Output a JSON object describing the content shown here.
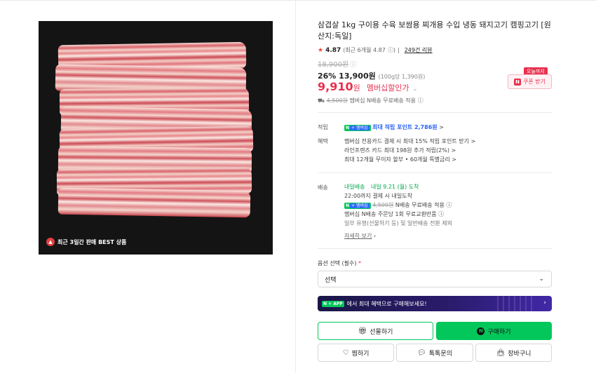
{
  "product": {
    "title": "삼겹살 1kg 구이용 수육 보쌈용 찌개용 수입 냉동 돼지고기 캠핑고기 [원산지:독일]",
    "image_badge": "최근 3일간 판매 BEST 상품",
    "rating_score": "4.87",
    "rating_recent": "(최근 6개월 4.87",
    "review_count": "249건 리뷰",
    "original_price": "18,900원",
    "discount_line": "26% 13,900원",
    "unit_price": "(100g당 1,390원)",
    "member_price": "9,910",
    "member_price_won": "원",
    "member_price_label": "멤버십할인가",
    "shipping_old": "4,500원",
    "shipping_text": "멤버십 N배송 무료배송 적용"
  },
  "coupon": {
    "tag": "오늘까지",
    "button_label": "쿠폰 받기"
  },
  "points": {
    "label": "적립",
    "pill_n": "N",
    "pill_m": "+ 멤버십",
    "text": "최대 적립 포인트 2,786원",
    "chev": ">"
  },
  "benefits": {
    "label": "혜택",
    "lines": [
      "멤버십 전용카드 결제 시 최대 15% 적립 포인트 받기 >",
      "라인프렌즈 카드 최대 198원 추가 적립(2%) >",
      "최대 12개월 무이자 할부 • 60개월 특별금리 >"
    ]
  },
  "delivery": {
    "label": "배송",
    "fast_badge": "내일배송",
    "fast_text": "내일 9.21 (월) 도착",
    "cutoff": "22:00까지 결제 시 내일도착",
    "ship_old": "4,500원",
    "ship_free": "N배송 무료배송 적용",
    "exchange": "멤버십 N배송 주문당 1회 무료교환반품",
    "exclude": "일부 유형(선물하기 등) 및 일반배송 전환 제외",
    "more": "자세히 보기"
  },
  "options": {
    "label": "옵션 선택 (필수)",
    "required_mark": "*",
    "selected": "선택"
  },
  "banner": {
    "pill": "N + APP",
    "text": "에서 최대 혜택으로 구매해보세요!"
  },
  "actions": {
    "gift": "선물하기",
    "buy": "구매하기",
    "wish": "찜하기",
    "talk": "톡톡문의",
    "cart": "장바구니"
  },
  "colors": {
    "accent_red": "#e8304e",
    "naver_green": "#03c75a",
    "link_blue": "#2a63f5"
  }
}
